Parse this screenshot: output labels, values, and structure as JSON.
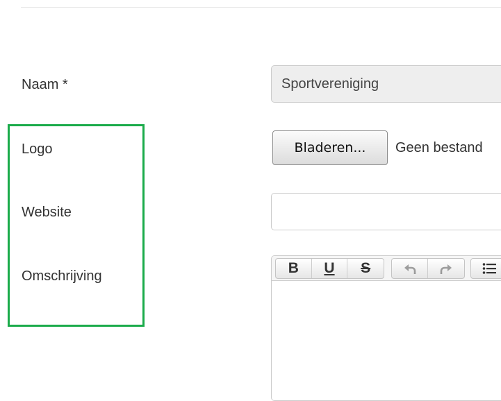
{
  "form": {
    "name_label": "Naam *",
    "name_value": "Sportvereniging",
    "logo_label": "Logo",
    "browse_button": "Bladeren...",
    "file_status": "Geen bestand",
    "website_label": "Website",
    "website_value": "",
    "description_label": "Omschrijving"
  },
  "toolbar": {
    "bold": "B",
    "underline": "U",
    "strike": "S"
  },
  "icons": [
    "undo-icon",
    "redo-icon",
    "bullet-list-icon"
  ],
  "colors": {
    "highlight": "#1aab4a"
  }
}
